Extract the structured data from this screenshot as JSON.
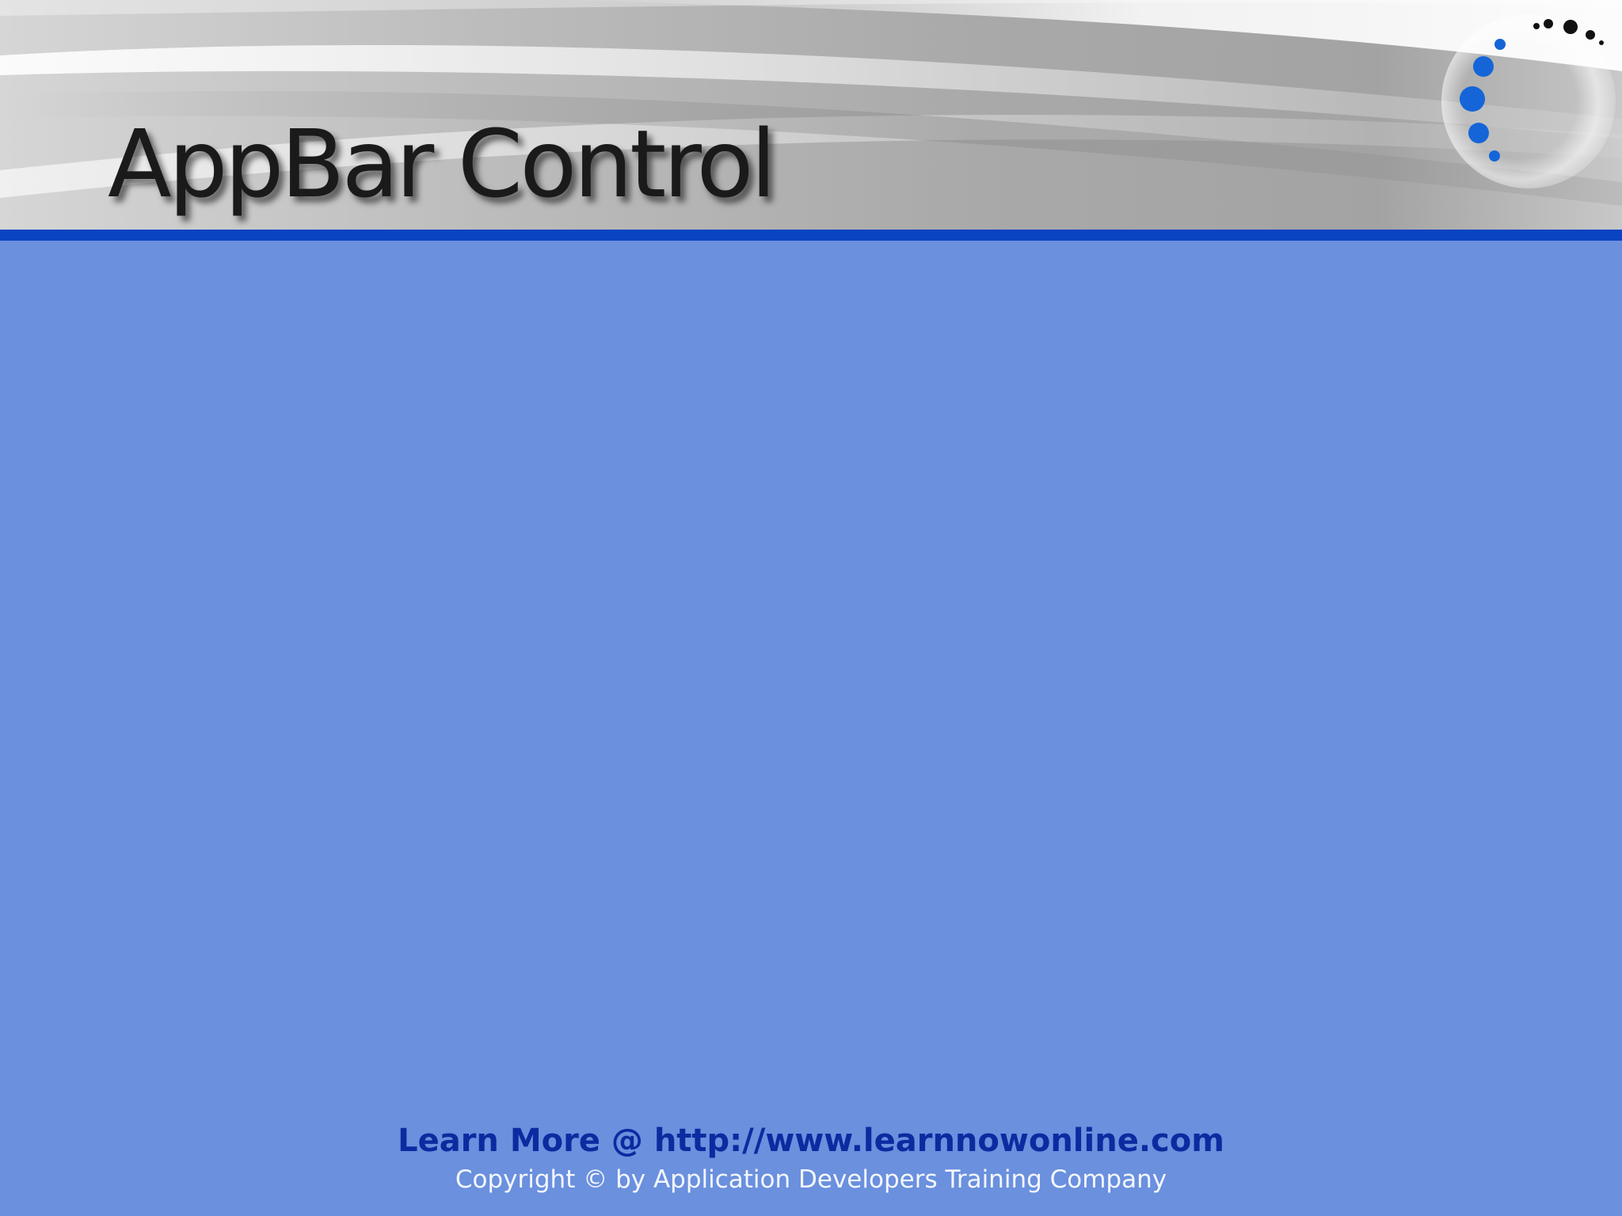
{
  "slide": {
    "title": "AppBar Control",
    "footer": {
      "learn_more": "Learn More @ http://www.learnnowonline.com",
      "copyright": "Copyright © by Application Developers Training Company"
    }
  },
  "logo": {
    "icon": "dotted-arc-logo-icon"
  },
  "colors": {
    "background": "#6a90de",
    "rule": "#0a44c2",
    "title": "#1a1a1a",
    "link": "#0d2aa0",
    "copyright": "#f4f6fc",
    "logo_dots_blue": "#1565d8",
    "logo_dots_dark": "#111111"
  }
}
